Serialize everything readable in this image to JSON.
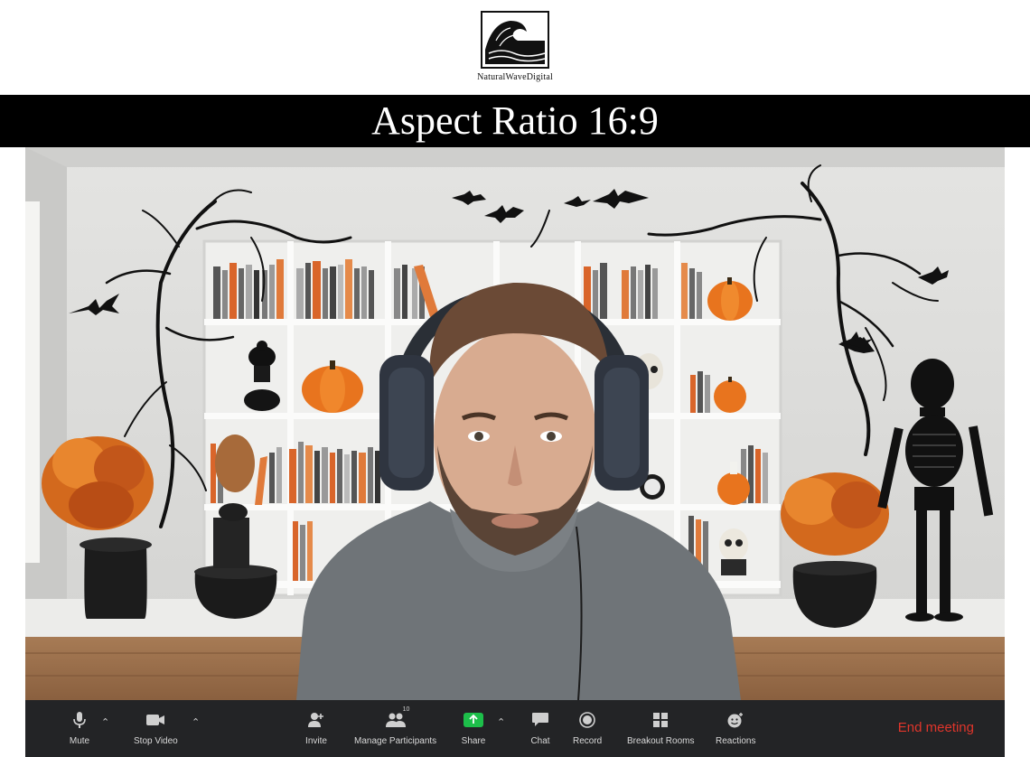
{
  "header": {
    "logo_text": "NaturalWaveDigital",
    "banner_title": "Aspect Ratio 16:9"
  },
  "toolbar": {
    "mute": "Mute",
    "stop_video": "Stop Video",
    "invite": "Invite",
    "manage_participants": "Manage Participants",
    "participant_count": "10",
    "share": "Share",
    "chat": "Chat",
    "record": "Record",
    "breakout_rooms": "Breakout Rooms",
    "reactions": "Reactions",
    "end_meeting": "End meeting"
  },
  "icons": {
    "mute": "microphone-icon",
    "video": "video-camera-icon",
    "invite": "add-person-icon",
    "participants": "people-icon",
    "share": "share-screen-icon",
    "chat": "chat-bubble-icon",
    "record": "record-icon",
    "breakout": "grid-icon",
    "reactions": "emoji-icon"
  },
  "colors": {
    "toolbar_bg": "#232426",
    "end_meeting": "#e0352b",
    "share_green": "#1dbf4a",
    "pumpkin": "#e8741e"
  }
}
